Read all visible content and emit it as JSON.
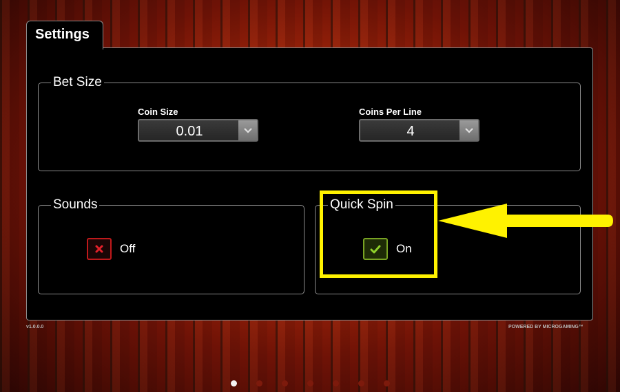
{
  "settings": {
    "tab_title": "Settings",
    "bet_size": {
      "legend": "Bet Size",
      "coin_size": {
        "label": "Coin Size",
        "value": "0.01"
      },
      "coins_per_line": {
        "label": "Coins Per Line",
        "value": "4"
      }
    },
    "sounds": {
      "legend": "Sounds",
      "state": "Off",
      "checked": false
    },
    "quick_spin": {
      "legend": "Quick Spin",
      "state": "On",
      "checked": true
    },
    "version": "v1.0.0.0",
    "powered_by": "POWERED BY MICROGAMING™"
  },
  "pagination": {
    "pages": 7,
    "active": 1
  },
  "annotation": {
    "color": "#fff200",
    "target": "quick-spin"
  },
  "colors": {
    "off": "#c0191b",
    "on": "#78a323",
    "panel": "#000000"
  }
}
